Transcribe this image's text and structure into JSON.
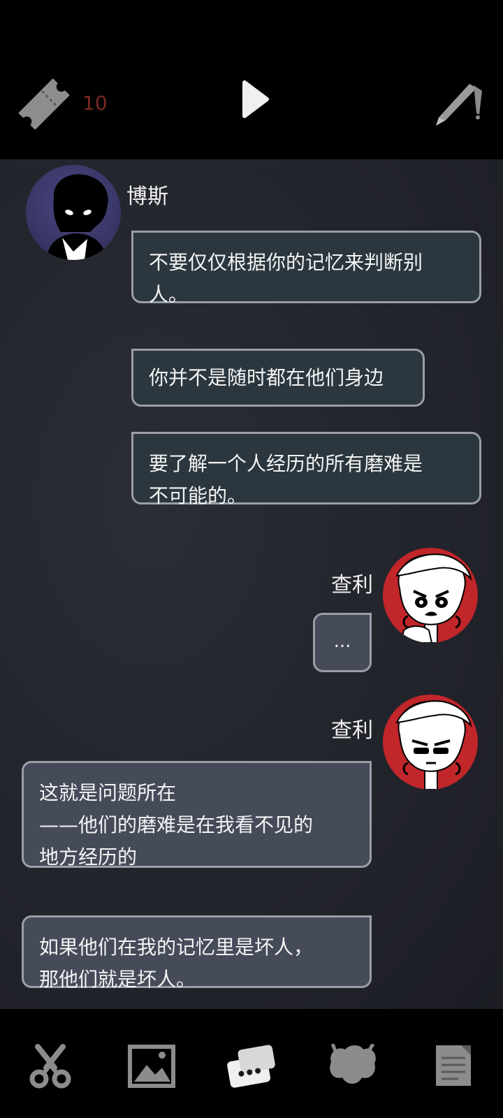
{
  "topbar": {
    "ticket_icon": "ticket-icon",
    "ticket_count": "10",
    "play_icon": "play-icon",
    "pen_icon": "pen-icon"
  },
  "chat": {
    "boss": {
      "name": "博斯",
      "messages": [
        "不要仅仅根据你的记忆来判断别\n人。",
        "你并不是随时都在他们身边",
        "要了解一个人经历的所有磨难是\n不可能的。"
      ]
    },
    "charlie_1": {
      "name": "查利",
      "message": "..."
    },
    "charlie_2": {
      "name": "查利",
      "messages": [
        "这就是问题所在\n——他们的磨难是在我看不见的\n地方经历的",
        "如果他们在我的记忆里是坏人，\n那他们就是坏人。"
      ]
    }
  },
  "bottom_nav": [
    {
      "icon": "scissors-icon"
    },
    {
      "icon": "photo-icon"
    },
    {
      "icon": "chat-icon"
    },
    {
      "icon": "creature-icon"
    },
    {
      "icon": "notes-icon"
    }
  ],
  "colors": {
    "accent_count": "#7a2a24",
    "bubble_left": "#2b363e",
    "bubble_right": "#464b5a",
    "charlie_avatar_bg": "#c0262a",
    "boss_avatar_bg": "#3a3768"
  }
}
